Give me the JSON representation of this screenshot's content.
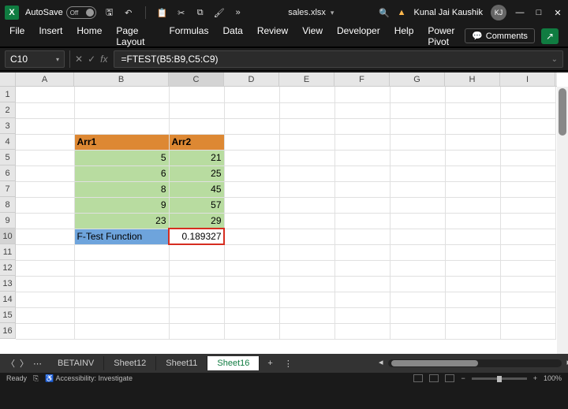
{
  "titlebar": {
    "autosave_label": "AutoSave",
    "autosave_state": "Off",
    "filename": "sales.xlsx",
    "username": "Kunal Jai Kaushik",
    "avatar_initials": "KJ"
  },
  "ribbon": {
    "tabs": [
      "File",
      "Insert",
      "Home",
      "Page Layout",
      "Formulas",
      "Data",
      "Review",
      "View",
      "Developer",
      "Help",
      "Power Pivot"
    ],
    "active_tab_index": 2,
    "comments_label": "Comments"
  },
  "formula_bar": {
    "cell_ref": "C10",
    "formula": "=FTEST(B5:B9,C5:C9)"
  },
  "grid": {
    "columns": [
      "A",
      "B",
      "C",
      "D",
      "E",
      "F",
      "G",
      "H",
      "I"
    ],
    "selected_col": "C",
    "rows": [
      1,
      2,
      3,
      4,
      5,
      6,
      7,
      8,
      9,
      10,
      11,
      12,
      13,
      14,
      15,
      16
    ],
    "selected_row": 10,
    "headers": {
      "b4": "Arr1",
      "c4": "Arr2"
    },
    "data": {
      "b5": "5",
      "c5": "21",
      "b6": "6",
      "c6": "25",
      "b7": "8",
      "c7": "45",
      "b8": "9",
      "c8": "57",
      "b9": "23",
      "c9": "29"
    },
    "footer": {
      "b10": "F-Test Function",
      "c10": "0.189327"
    }
  },
  "sheet_tabs": {
    "tabs": [
      "BETAINV",
      "Sheet12",
      "Sheet11",
      "Sheet16"
    ],
    "active_index": 3
  },
  "statusbar": {
    "state": "Ready",
    "accessibility": "Accessibility: Investigate",
    "zoom": "100%"
  }
}
